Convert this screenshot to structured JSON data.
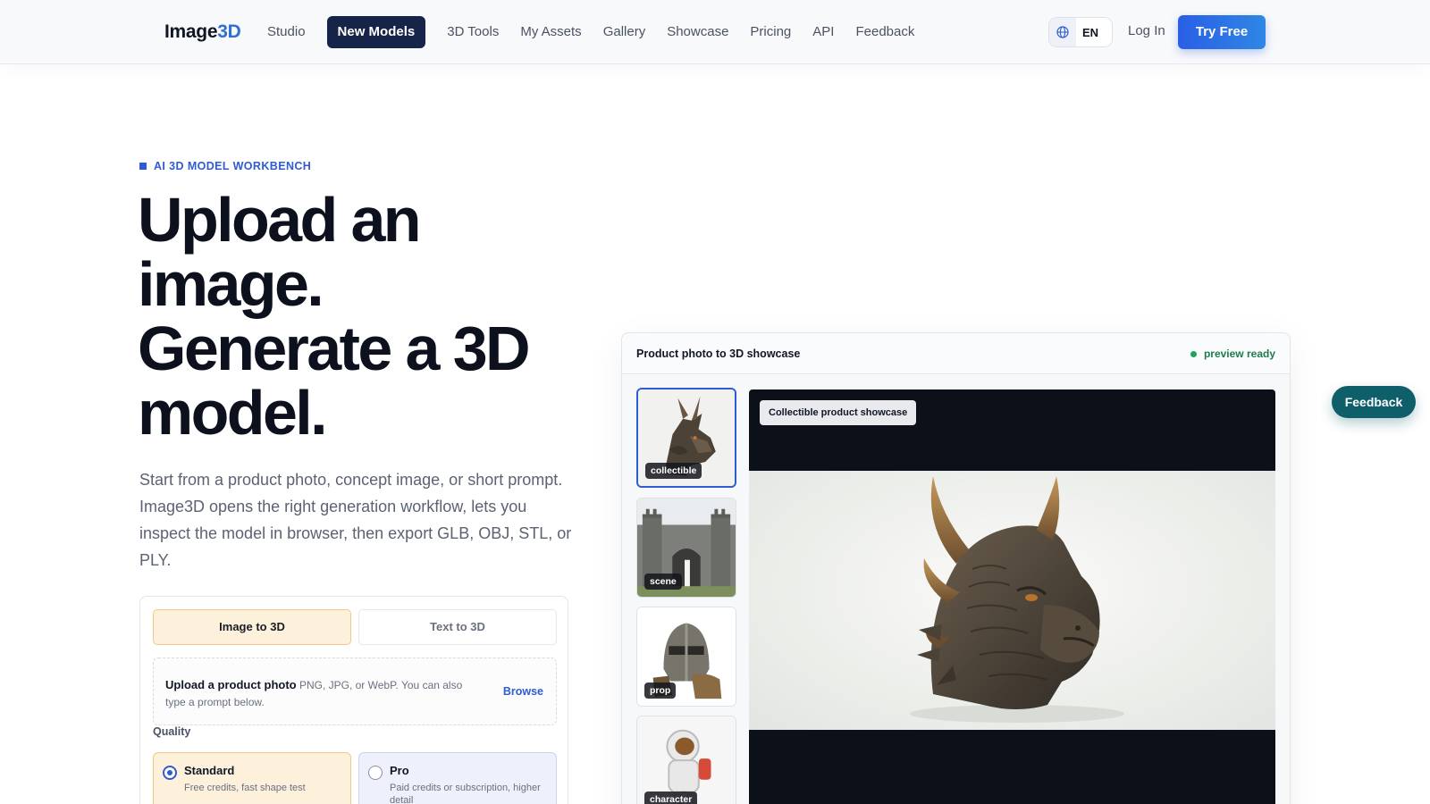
{
  "brand": {
    "name_main": "Image",
    "name_accent": "3D"
  },
  "nav": {
    "items": [
      {
        "label": "Studio"
      },
      {
        "label": "New Models"
      },
      {
        "label": "3D Tools"
      },
      {
        "label": "My Assets"
      },
      {
        "label": "Gallery"
      },
      {
        "label": "Showcase"
      },
      {
        "label": "Pricing"
      },
      {
        "label": "API"
      },
      {
        "label": "Feedback"
      }
    ],
    "active_index": 1
  },
  "header": {
    "language_code": "EN",
    "login_label": "Log In",
    "cta_label": "Try Free"
  },
  "hero": {
    "eyebrow": "AI 3D MODEL WORKBENCH",
    "headline_lines": [
      "Upload an",
      "image.",
      "Generate a 3D",
      "model."
    ],
    "subtext": "Start from a product photo, concept image, or short prompt. Image3D opens the right generation workflow, lets you inspect the model in browser, then export GLB, OBJ, STL, or PLY."
  },
  "workbench": {
    "tabs": [
      {
        "label": "Image to 3D",
        "selected": true
      },
      {
        "label": "Text to 3D",
        "selected": false
      }
    ],
    "upload": {
      "title": "Upload a product photo",
      "hint": "PNG, JPG, or WebP. You can also type a prompt below.",
      "browse_label": "Browse"
    },
    "quality_label": "Quality",
    "options": [
      {
        "title": "Standard",
        "desc": "Free credits, fast shape test",
        "selected": true
      },
      {
        "title": "Pro",
        "desc": "Paid credits or subscription, higher detail",
        "selected": false
      }
    ]
  },
  "showcase": {
    "title": "Product photo to 3D showcase",
    "status": "preview ready",
    "status_color": "#22a35a",
    "thumbnails": [
      {
        "tag": "collectible",
        "icon": "dragon-head-icon",
        "selected": true
      },
      {
        "tag": "scene",
        "icon": "castle-gate-icon",
        "selected": false
      },
      {
        "tag": "prop",
        "icon": "knight-helmet-icon",
        "selected": false
      },
      {
        "tag": "character",
        "icon": "astronaut-icon",
        "selected": false
      }
    ],
    "viewer_chip": "Collectible product showcase"
  },
  "floating_feedback": {
    "label": "Feedback"
  },
  "colors": {
    "accent": "#2f5bd3",
    "nav_active": "#16244a",
    "cta": "#2a5ee6",
    "feedback_pill": "#0f5f6b",
    "option_warm": "#fdf1dc",
    "option_cool": "#eef0fc"
  }
}
